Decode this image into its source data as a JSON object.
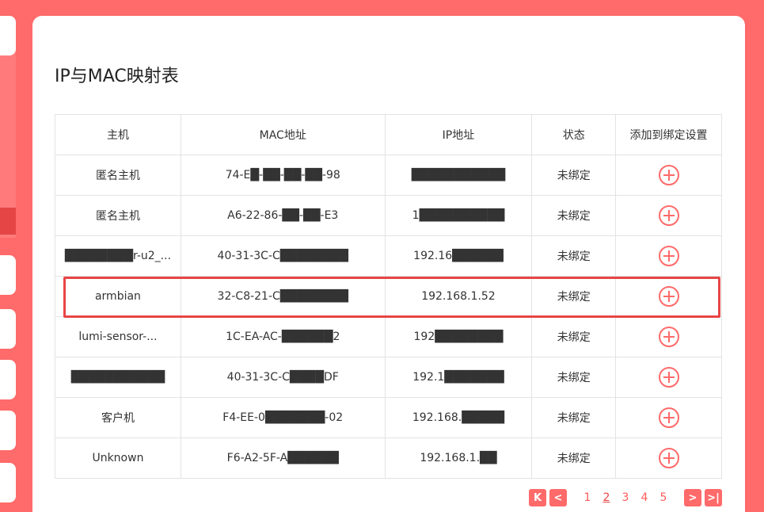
{
  "title": "IP与MAC映射表",
  "columns": [
    "主机",
    "MAC地址",
    "IP地址",
    "状态",
    "添加到绑定设置"
  ],
  "rows": [
    {
      "host": "匿名主机",
      "mac": "74-E█-██-██-██-98",
      "ip": "███████████",
      "status": "未绑定"
    },
    {
      "host": "匿名主机",
      "mac": "A6-22-86-██-██-E3",
      "ip": "1██████████",
      "status": "未绑定"
    },
    {
      "host": "████████r-u2_...",
      "mac": "40-31-3C-C████████",
      "ip": "192.16██████",
      "status": "未绑定"
    },
    {
      "host": "armbian",
      "mac": "32-C8-21-C████████",
      "ip": "192.168.1.52",
      "status": "未绑定"
    },
    {
      "host": "lumi-sensor-...",
      "mac": "1C-EA-AC-██████2",
      "ip": "192████████",
      "status": "未绑定"
    },
    {
      "host": "███████████",
      "mac": "40-31-3C-C████DF",
      "ip": "192.1███████",
      "status": "未绑定"
    },
    {
      "host": "客户机",
      "mac": "F4-EE-0███████-02",
      "ip": "192.168.█████",
      "status": "未绑定"
    },
    {
      "host": "Unknown",
      "mac": "F6-A2-5F-A██████",
      "ip": "192.168.1.██",
      "status": "未绑定"
    }
  ],
  "pager": {
    "first": "K",
    "prev": "<",
    "pages": [
      "1",
      "2",
      "3",
      "4",
      "5"
    ],
    "current": "2",
    "next": ">",
    "last": ">|"
  },
  "colors": {
    "accent": "#ff6a6a",
    "highlight": "#e84545",
    "border": "#e3e3e3"
  }
}
